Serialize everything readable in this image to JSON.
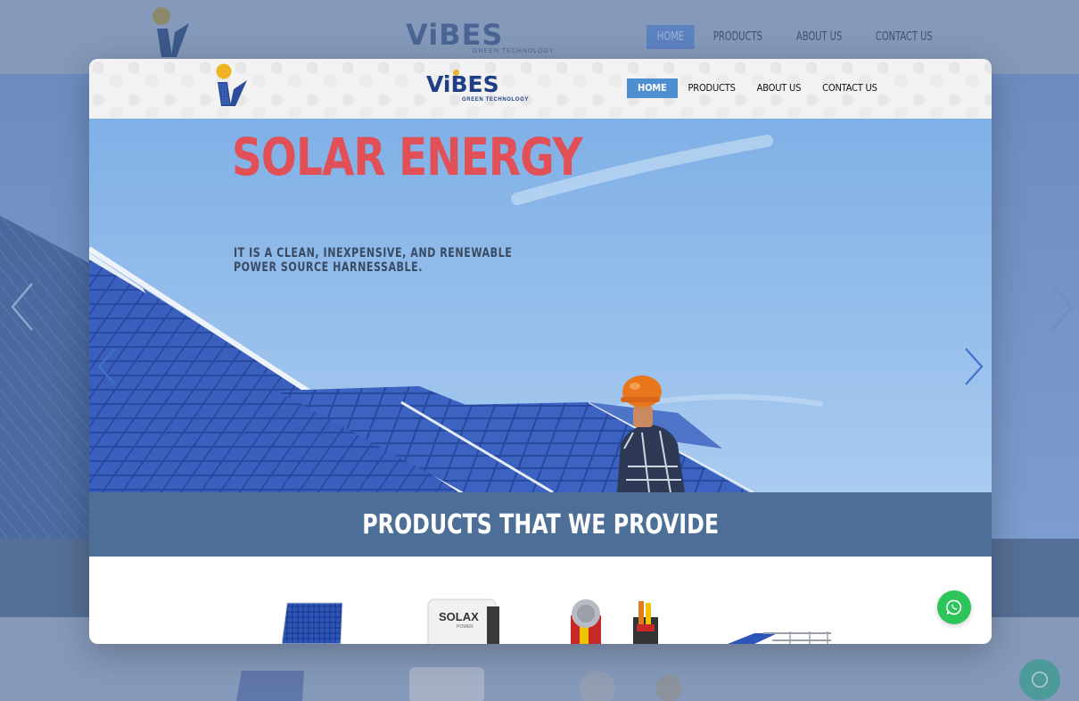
{
  "colors": {
    "accent": "#4d8fd1",
    "title_red": "#e05056",
    "band": "#4d6f97",
    "whatsapp": "#2dc45a",
    "brand_blue": "#1e3f86"
  },
  "brand": {
    "name_prefix": "Vi",
    "name_suffix": "BES",
    "tagline": "GREEN TECHNOLOGY"
  },
  "nav": {
    "items": [
      {
        "label": "HOME",
        "active": true
      },
      {
        "label": "PRODUCTS",
        "active": false
      },
      {
        "label": "ABOUT US",
        "active": false
      },
      {
        "label": "CONTACT US",
        "active": false
      }
    ]
  },
  "hero": {
    "title": "SOLAR ENERGY",
    "subtitle_line1": "IT IS A CLEAN, INEXPENSIVE, AND RENEWABLE",
    "subtitle_line2": "POWER SOURCE HARNESSABLE."
  },
  "products_section": {
    "title": "PRODUCTS THAT WE PROVIDE",
    "inverter_brand": "SOLAX",
    "inverter_brand_sub": "POWER"
  },
  "icons": {
    "logo": "vi-logo-icon",
    "prev": "chevron-left-icon",
    "next": "chevron-right-icon",
    "chat": "whatsapp-icon"
  }
}
